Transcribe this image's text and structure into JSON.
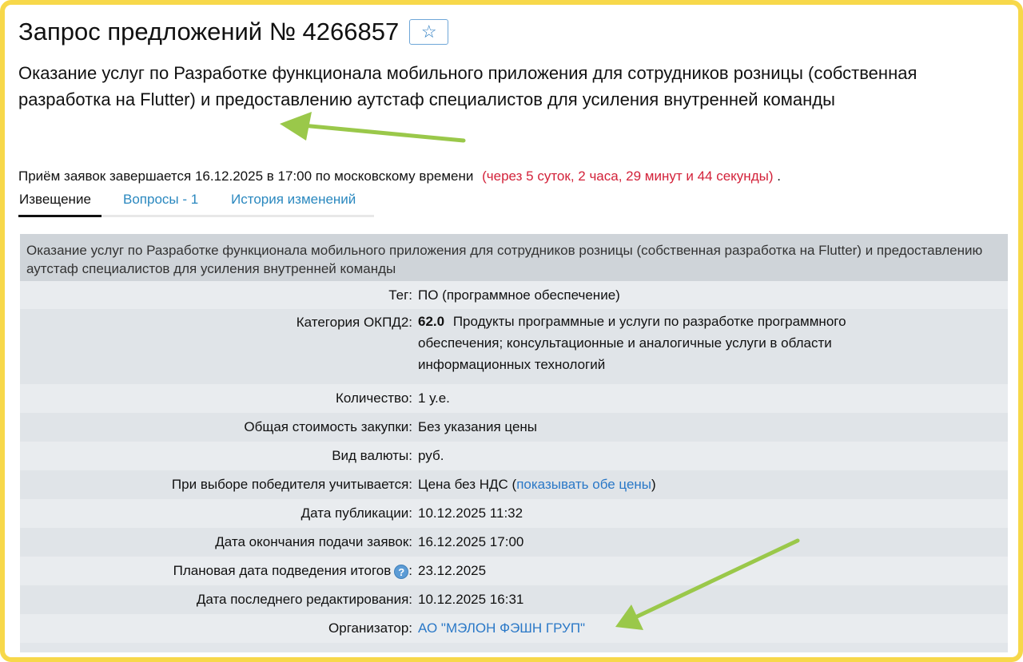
{
  "header": {
    "title": "Запрос предложений № 4266857",
    "favorite_icon": "star-outline-icon",
    "subject": "Оказание услуг по Разработке функционала мобильного приложения для сотрудников розницы (собственная разработка на Flutter) и предоставлению аутстаф специалистов для усиления внутренней команды"
  },
  "deadline": {
    "text": "Приём заявок завершается 16.12.2025 в 17:00 по московскому времени",
    "countdown": "(через 5 суток, 2 часа, 29 минут и 44 секунды)",
    "dot": "."
  },
  "tabs": [
    {
      "label": "Извещение",
      "active": true
    },
    {
      "label": "Вопросы - 1",
      "active": false
    },
    {
      "label": "История изменений",
      "active": false
    }
  ],
  "panel": {
    "heading": "Оказание услуг по Разработке функционала мобильного приложения для сотрудников розницы (собственная разработка на Flutter) и предоставлению аутстаф специалистов для усиления внутренней команды",
    "rows": {
      "tag": {
        "label": "Тег:",
        "value": "ПО (программное обеспечение)"
      },
      "okpd": {
        "label": "Категория ОКПД2:",
        "code": "62.0",
        "value": "Продукты программные и услуги по разработке программного обеспечения; консультационные и аналогичные услуги в области информационных технологий"
      },
      "qty": {
        "label": "Количество:",
        "value": "1 у.е."
      },
      "cost": {
        "label": "Общая стоимость закупки:",
        "value": "Без указания цены"
      },
      "currency": {
        "label": "Вид валюты:",
        "value": "руб."
      },
      "winner": {
        "label": "При выборе победителя учитывается:",
        "value": "Цена без НДС (",
        "link": "показывать обе цены",
        "suffix": ")"
      },
      "published": {
        "label": "Дата публикации:",
        "value": "10.12.2025 11:32"
      },
      "end": {
        "label": "Дата окончания подачи заявок:",
        "value": "16.12.2025 17:00"
      },
      "results": {
        "label": "Плановая дата подведения итогов",
        "help_icon": "help-icon",
        "help_glyph": "?",
        "colon": ":",
        "value": "23.12.2025"
      },
      "edited": {
        "label": "Дата последнего редактирования:",
        "value": "10.12.2025 16:31"
      },
      "organizer": {
        "label": "Организатор:",
        "value": "АО \"МЭЛОН ФЭШН ГРУП\""
      }
    }
  },
  "colors": {
    "frame": "#f7d84a",
    "arrow": "#9ac84a",
    "link": "#2a78c7",
    "countdown": "#d3223a"
  }
}
